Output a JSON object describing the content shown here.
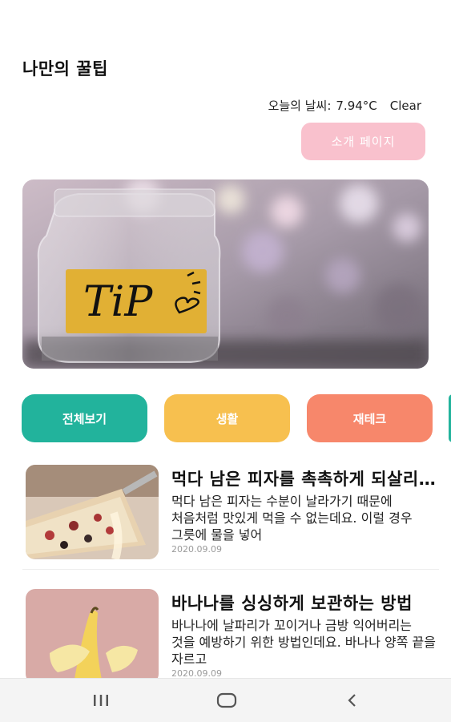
{
  "header": {
    "title": "나만의 꿀팁"
  },
  "weather": {
    "label": "오늘의 날씨:",
    "temp": "7.94°C",
    "condition": "Clear"
  },
  "intro_button": {
    "label": "소개 페이지"
  },
  "banner": {
    "text": "TiP",
    "icon": "heart-icon"
  },
  "categories": [
    {
      "label": "전체보기",
      "color": "#22b39c"
    },
    {
      "label": "생활",
      "color": "#f7c04f"
    },
    {
      "label": "재테크",
      "color": "#f7876b"
    }
  ],
  "posts": [
    {
      "title": "먹다 남은 피자를 촉촉하게 되살리는 방법",
      "desc": "먹다 남은 피자는 수분이 날라가기 때문에 처음처럼 맛있게 먹을 수 없는데요. 이럴 경우 그릇에 물을 넣어",
      "date": "2020.09.09"
    },
    {
      "title": "바나나를 싱싱하게 보관하는 방법",
      "desc": "바나나에 날파리가 꼬이거나 금방 익어버리는 것을 예방하기 위한 방법인데요. 바나나 양쪽 끝을 자르고",
      "date": "2020.09.09"
    }
  ],
  "navbar": {
    "icons": [
      "recent-apps-icon",
      "home-icon",
      "back-icon"
    ]
  }
}
